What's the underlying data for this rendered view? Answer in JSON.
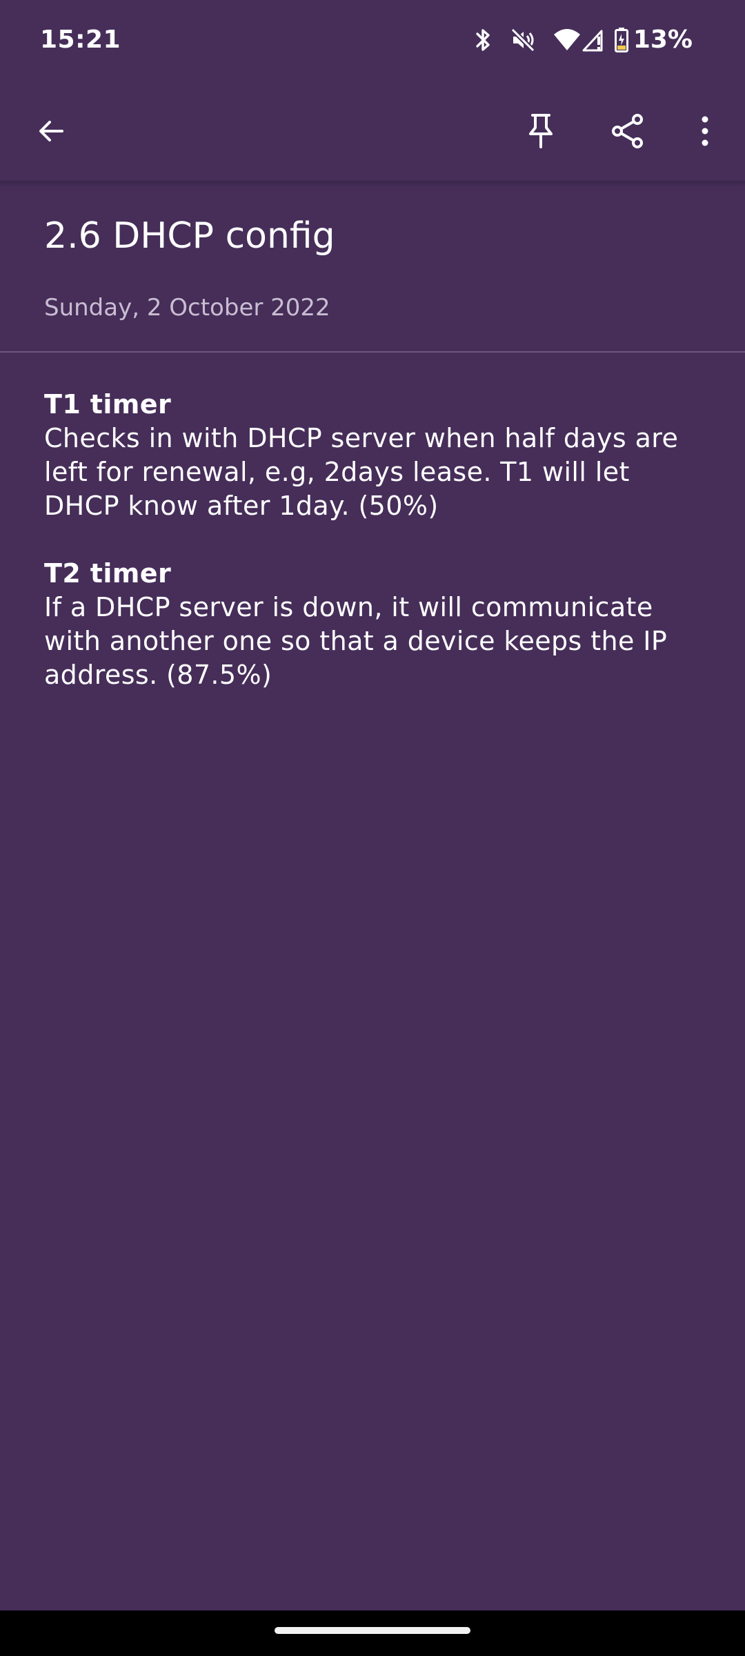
{
  "status_bar": {
    "time": "15:21",
    "battery_percent": "13%",
    "icons": [
      "bluetooth-icon",
      "vibrate-off-icon",
      "wifi-icon",
      "signal-icon",
      "battery-charging-icon"
    ]
  },
  "toolbar": {
    "icons": [
      "back-arrow-icon",
      "pin-icon",
      "share-icon",
      "more-vert-icon"
    ]
  },
  "note": {
    "title": "2.6 DHCP config",
    "date": "Sunday, 2 October 2022",
    "sections": [
      {
        "heading": "T1 timer",
        "text": "Checks in with DHCP server when half days are left for renewal, e.g, 2days lease. T1 will let DHCP know after 1day. (50%)"
      },
      {
        "heading": "T2 timer",
        "text": "If a DHCP server is down, it will communicate with another one so that a device keeps the IP address. (87.5%)"
      }
    ]
  },
  "colors": {
    "background": "#462e59",
    "text": "#ffffff",
    "date_text": "#c9bdd2",
    "divider": "#6a5680",
    "nav_bar": "#000000"
  }
}
